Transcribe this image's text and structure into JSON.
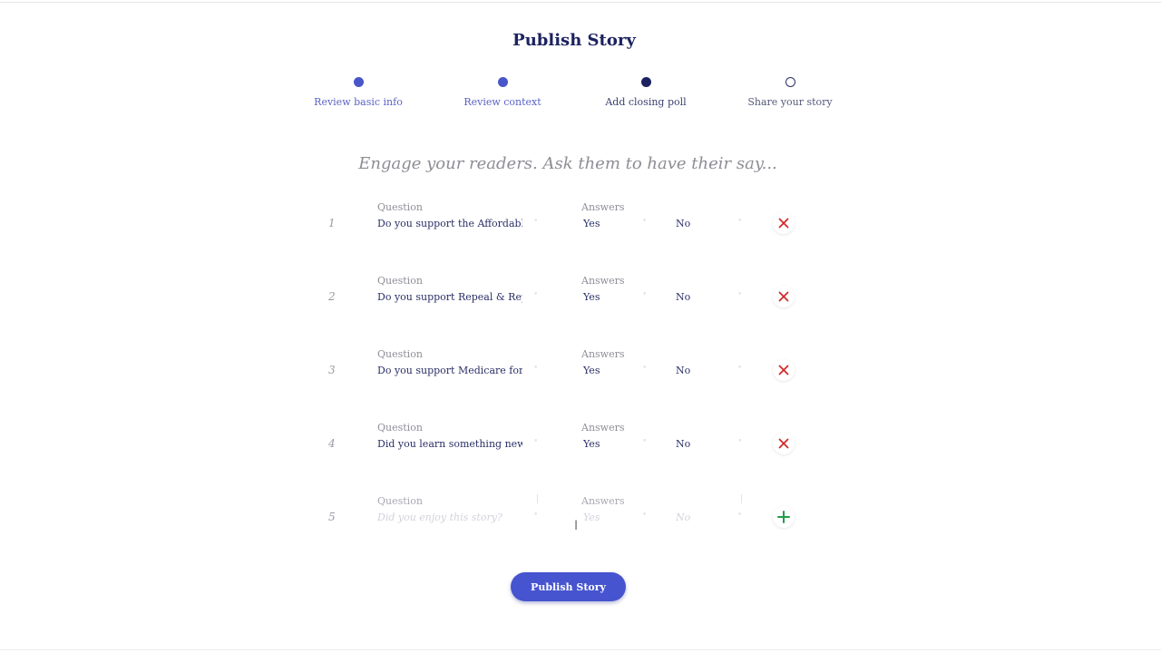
{
  "page": {
    "title": "Publish Story",
    "subtitle": "Engage your readers. Ask them to have their say..."
  },
  "steps": [
    {
      "label": "Review basic info",
      "state": "done"
    },
    {
      "label": "Review context",
      "state": "done"
    },
    {
      "label": "Add closing poll",
      "state": "current"
    },
    {
      "label": "Share your story",
      "state": "todo"
    }
  ],
  "poll": {
    "question_label": "Question",
    "answers_label": "Answers",
    "questions": [
      {
        "number": "1",
        "question": "Do you support the Affordable C",
        "answer1": "Yes",
        "answer2": "No"
      },
      {
        "number": "2",
        "question": "Do you support Repeal & Replac",
        "answer1": "Yes",
        "answer2": "No"
      },
      {
        "number": "3",
        "question": "Do you support Medicare for All?",
        "answer1": "Yes",
        "answer2": "No"
      },
      {
        "number": "4",
        "question": "Did you learn something new thi",
        "answer1": "Yes",
        "answer2": "No"
      }
    ],
    "new_question": {
      "number": "5",
      "question_placeholder": "Did you enjoy this story?",
      "answer1_placeholder": "Yes",
      "answer2_placeholder": "No"
    }
  },
  "icons": {
    "remove": "close-icon",
    "add": "plus-icon"
  },
  "colors": {
    "accent": "#4654d0",
    "remove": "#d12b2b",
    "add": "#1e9e4a",
    "title": "#1c2260"
  },
  "publish_button": {
    "label": "Publish Story"
  }
}
